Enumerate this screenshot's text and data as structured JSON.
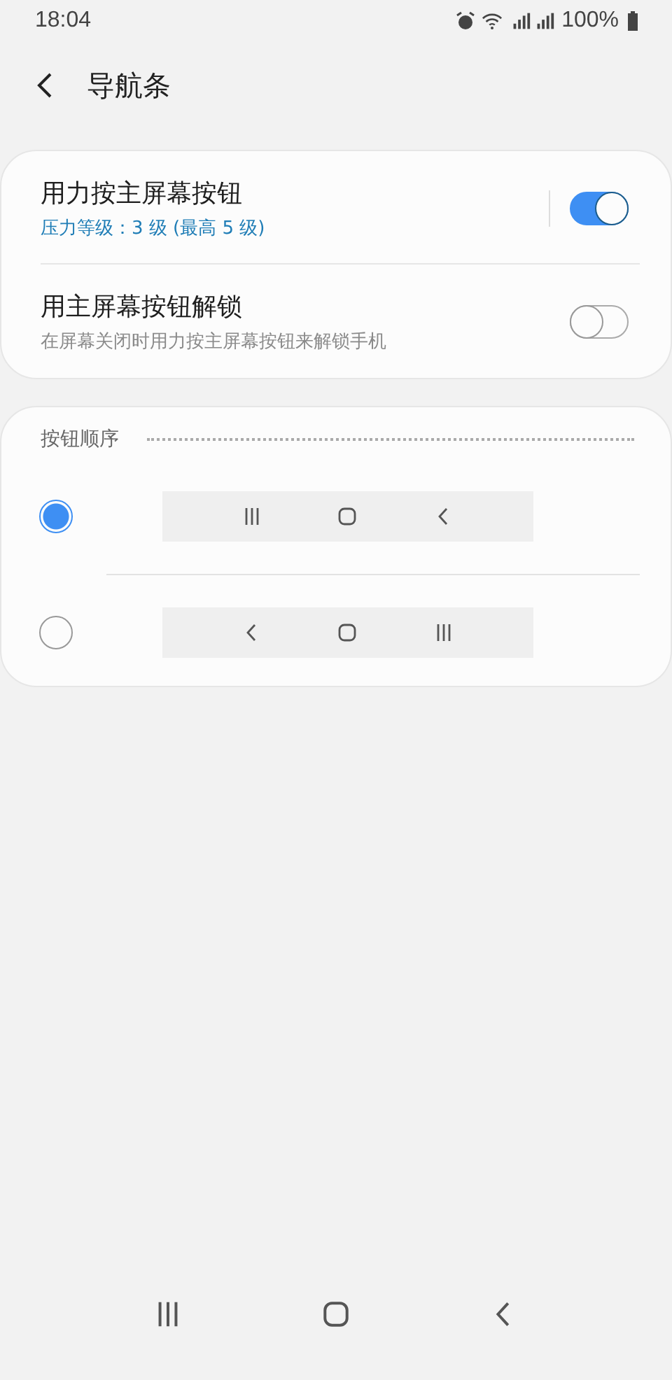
{
  "status_bar": {
    "time": "18:04",
    "battery": "100%"
  },
  "header": {
    "title": "导航条"
  },
  "settings": [
    {
      "title": "用力按主屏幕按钮",
      "subtitle": "压力等级：3 级 (最高 5 级)",
      "subtitle_accent": true,
      "on": true,
      "divider": true
    },
    {
      "title": "用主屏幕按钮解锁",
      "subtitle": "在屏幕关闭时用力按主屏幕按钮来解锁手机",
      "subtitle_accent": false,
      "on": false,
      "divider": false
    }
  ],
  "button_order": {
    "heading": "按钮顺序",
    "options": [
      {
        "selected": true,
        "keys": [
          {
            "kind": "recent"
          },
          {
            "kind": "home"
          },
          {
            "kind": "back"
          }
        ]
      },
      {
        "selected": false,
        "keys": [
          {
            "kind": "back"
          },
          {
            "kind": "home"
          },
          {
            "kind": "recent"
          }
        ]
      }
    ]
  },
  "nav_bar": {
    "keys": [
      {
        "kind": "recent"
      },
      {
        "kind": "home"
      },
      {
        "kind": "back"
      }
    ]
  }
}
